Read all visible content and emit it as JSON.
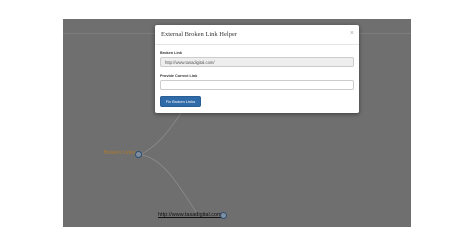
{
  "modal": {
    "title": "External Broken Link Helper",
    "close_glyph": "×",
    "broken_link_label": "Broken Link",
    "broken_link_value": "http://www.tasadigital.com/",
    "correct_link_label": "Provide Correct Link",
    "correct_link_value": "",
    "fix_button_label": "Fix Broken Links"
  },
  "mindmap": {
    "broken_node_label": "Broken Links",
    "url_node_label": "http://www.tasadigital.com/"
  },
  "colors": {
    "overlay_gray": "#6f6f6f",
    "primary_button": "#2f6ba8",
    "broken_label": "#b07a2a"
  },
  "icons": {
    "close": "close-icon",
    "node": "node-circle-icon"
  }
}
